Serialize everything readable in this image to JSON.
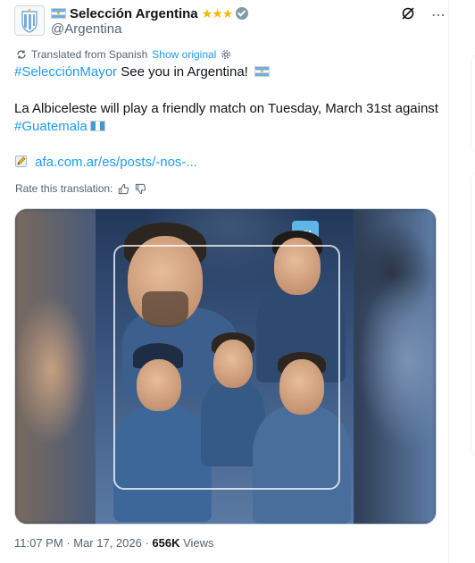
{
  "account": {
    "display_name": "Selección Argentina",
    "stars": "★★★",
    "handle": "@Argentina"
  },
  "translation": {
    "label": "Translated from Spanish",
    "show_original": "Show original"
  },
  "tweet": {
    "line1_hashtag": "#SelecciónMayor",
    "line1_text": " See you in Argentina!",
    "line2_text": "La Albiceleste will play a friendly match on Tuesday, March 31st against",
    "line3_hashtag": "#Guatemala",
    "link_text": "afa.com.ar/es/posts/-nos-..."
  },
  "rate_translation": "Rate this translation:",
  "media": {
    "badge_text": "AFA"
  },
  "meta": {
    "time": "11:07 PM",
    "separator1": " · ",
    "date": "Mar 17, 2026",
    "separator2": " · ",
    "views_count": "656K",
    "views_label": " Views"
  },
  "icons": {
    "grok": "grok-icon",
    "more": "more-icon",
    "translate": "translate-icon",
    "settings": "gear-icon",
    "pencil": "pencil-icon",
    "thumbs_up": "thumbs-up-icon",
    "thumbs_down": "thumbs-down-icon"
  },
  "colors": {
    "link": "#1d9bf0",
    "secondary_text": "#536471",
    "primary_text": "#0f1419",
    "stars": "#f0b90b",
    "verified_badge": "#829aab"
  }
}
